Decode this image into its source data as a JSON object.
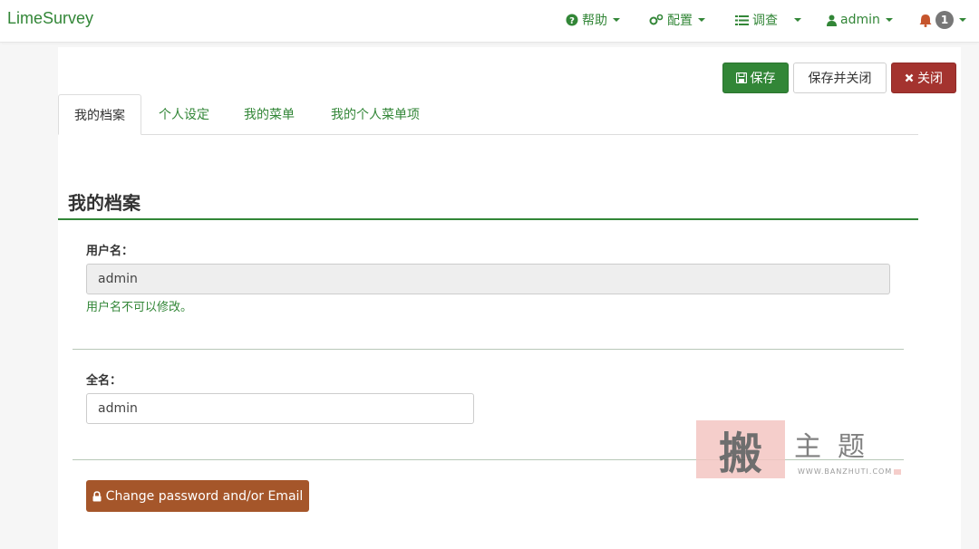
{
  "navbar": {
    "brand": "LimeSurvey",
    "help": "帮助",
    "config": "配置",
    "surveys": "调查",
    "user": "admin",
    "notifications_count": "1"
  },
  "actions": {
    "save": "保存",
    "save_close": "保存并关闭",
    "close": "关闭"
  },
  "tabs": [
    {
      "label": "我的档案",
      "active": true
    },
    {
      "label": "个人设定",
      "active": false
    },
    {
      "label": "我的菜单",
      "active": false
    },
    {
      "label": "我的个人菜单项",
      "active": false
    }
  ],
  "profile": {
    "title": "我的档案",
    "username_label": "用户名：",
    "username_value": "admin",
    "username_help": "用户名不可以修改。",
    "fullname_label": "全名：",
    "fullname_value": "admin",
    "password_button": "Change password and/or Email"
  },
  "watermark": {
    "seal": "搬",
    "text": "主题",
    "url": "WWW.BANZHUTI.COM"
  },
  "colors": {
    "accent": "#328637",
    "danger": "#a4332f",
    "warning": "#a5562a"
  }
}
